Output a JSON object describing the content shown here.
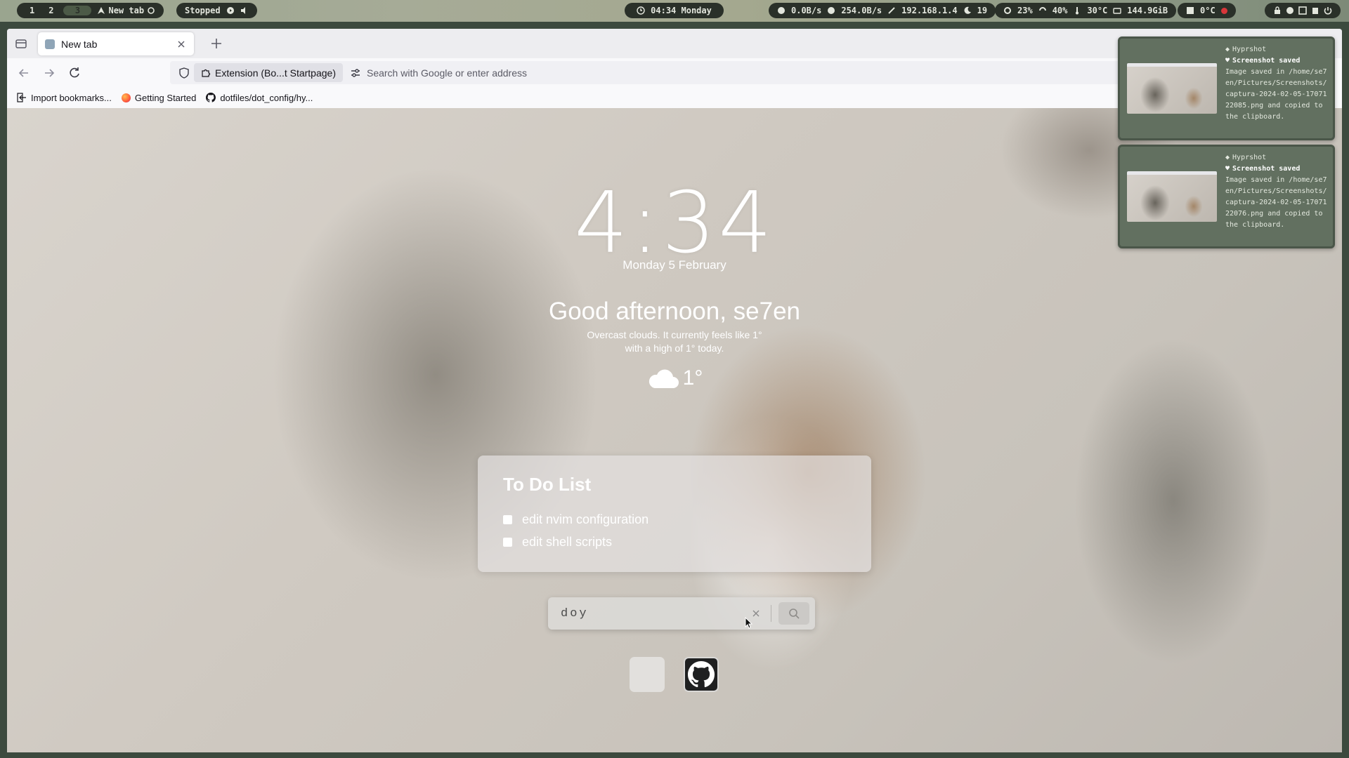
{
  "topbar": {
    "workspaces": [
      "1",
      "2",
      "3"
    ],
    "active_workspace": "3",
    "window_title": "New tab",
    "media": "Stopped",
    "clock": "04:34 Monday",
    "network": {
      "down": "0.0B/s",
      "up": "254.0B/s",
      "ip": "192.168.1.4",
      "count": "19"
    },
    "system": {
      "cpu": "23%",
      "memory": "40%",
      "temp": "30°C",
      "disk": "144.9GiB"
    },
    "weather": "0°C"
  },
  "browser": {
    "tab_title": "New tab",
    "url_extension_label": "Extension (Bo...t Startpage)",
    "url_placeholder": "Search with Google or enter address",
    "bookmarks": [
      {
        "label": "Import bookmarks...",
        "icon": "import-icon"
      },
      {
        "label": "Getting Started",
        "icon": "firefox-icon"
      },
      {
        "label": "dotfiles/dot_config/hy...",
        "icon": "github-icon"
      }
    ]
  },
  "startpage": {
    "time": "4:34",
    "date": "Monday 5 February",
    "greeting": "Good afternoon, se7en",
    "weather_line1": "Overcast clouds. It currently feels like 1°",
    "weather_line2": "with a high of 1° today.",
    "temperature": "1°",
    "weather_icon": "cloud-icon",
    "todo": {
      "title": "To Do List",
      "items": [
        {
          "label": "edit nvim configuration",
          "checked": false
        },
        {
          "label": "edit shell scripts",
          "checked": false
        }
      ]
    },
    "search_value": "doy",
    "shortcuts": [
      "blank-shortcut",
      "github-icon"
    ]
  },
  "notifications": [
    {
      "app": "Hyprshot",
      "summary": "Screenshot saved",
      "body": "Image saved in /home/se7en/Pictures/Screenshots/captura-2024-02-05-1707122085.png and copied to the clipboard."
    },
    {
      "app": "Hyprshot",
      "summary": "Screenshot saved",
      "body": "Image saved in /home/se7en/Pictures/Screenshots/captura-2024-02-05-1707122076.png and copied to the clipboard."
    }
  ],
  "colors": {
    "bar_pill": "#2a3029",
    "notification_bg": "#627060",
    "record_dot": "#d8363a"
  }
}
